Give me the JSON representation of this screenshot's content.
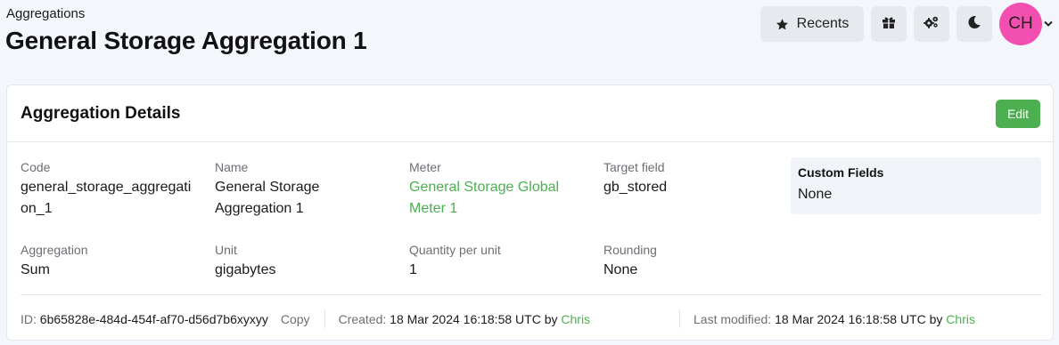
{
  "header": {
    "breadcrumb": "Aggregations",
    "title": "General Storage Aggregation 1"
  },
  "topbar": {
    "recents_label": "Recents",
    "avatar_initials": "CH",
    "icons": [
      "star-icon",
      "gift-icon",
      "settings-cogs-icon",
      "moon-icon",
      "chevron-down-icon"
    ]
  },
  "card": {
    "title": "Aggregation Details",
    "edit_label": "Edit",
    "fields": {
      "code": {
        "label": "Code",
        "value": "general_storage_aggregation_1"
      },
      "name": {
        "label": "Name",
        "value": "General Storage Aggregation 1"
      },
      "meter": {
        "label": "Meter",
        "value": "General Storage Global Meter 1"
      },
      "target_field": {
        "label": "Target field",
        "value": "gb_stored"
      },
      "aggregation": {
        "label": "Aggregation",
        "value": "Sum"
      },
      "unit": {
        "label": "Unit",
        "value": "gigabytes"
      },
      "quantity_per_unit": {
        "label": "Quantity per unit",
        "value": "1"
      },
      "rounding": {
        "label": "Rounding",
        "value": "None"
      }
    },
    "custom_fields": {
      "title": "Custom Fields",
      "value": "None"
    },
    "footer": {
      "id_label": "ID:",
      "id_value": "6b65828e-484d-454f-af70-d56d7b6xyxyy",
      "copy_label": "Copy",
      "created_label": "Created:",
      "created_value": "18 Mar 2024 16:18:58 UTC",
      "created_by_word": "by",
      "created_by": "Chris",
      "modified_label": "Last modified:",
      "modified_value": "18 Mar 2024 16:18:58 UTC",
      "modified_by_word": "by",
      "modified_by": "Chris"
    }
  },
  "colors": {
    "accent_green": "#4caf50",
    "avatar_pink": "#f24fb0",
    "page_bg": "#f3f6fa"
  }
}
